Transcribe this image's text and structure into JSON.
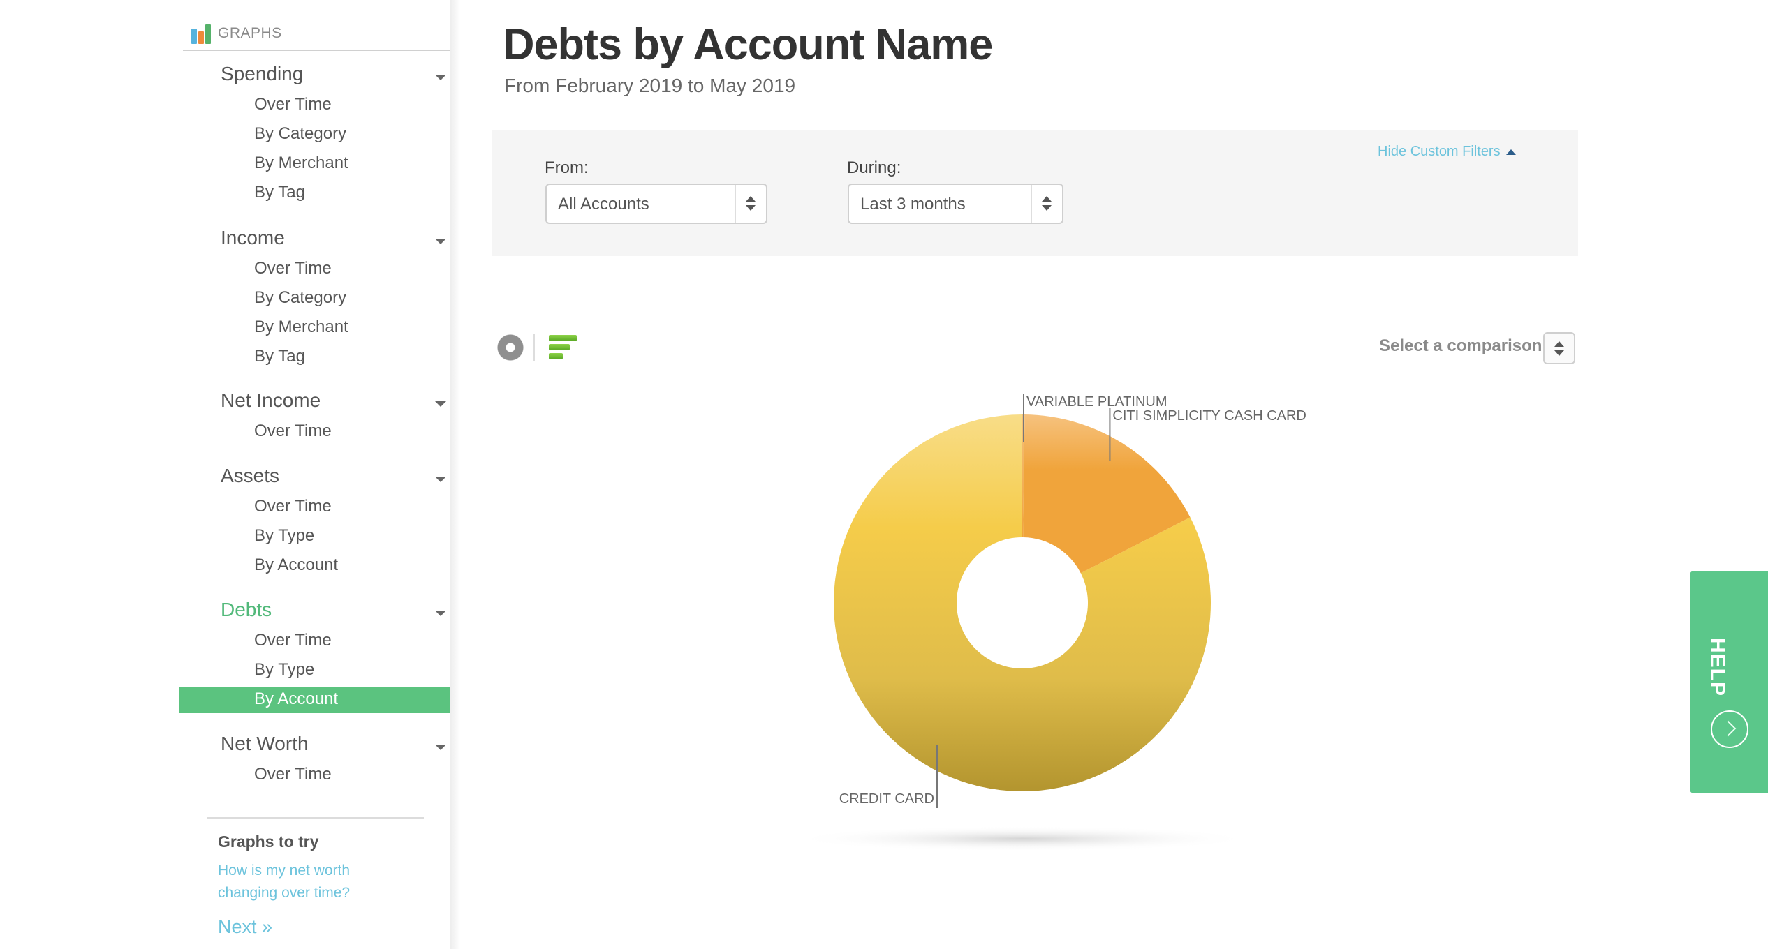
{
  "sidebar": {
    "header": {
      "label": "GRAPHS",
      "icon": "bar-chart-icon"
    },
    "sections": [
      {
        "label": "Spending",
        "items": [
          "Over Time",
          "By Category",
          "By Merchant",
          "By Tag"
        ]
      },
      {
        "label": "Income",
        "items": [
          "Over Time",
          "By Category",
          "By Merchant",
          "By Tag"
        ]
      },
      {
        "label": "Net Income",
        "items": [
          "Over Time"
        ]
      },
      {
        "label": "Assets",
        "items": [
          "Over Time",
          "By Type",
          "By Account"
        ]
      },
      {
        "label": "Debts",
        "items": [
          "Over Time",
          "By Type",
          "By Account"
        ],
        "active": true,
        "active_item": "By Account"
      },
      {
        "label": "Net Worth",
        "items": [
          "Over Time"
        ]
      }
    ],
    "graphs_to_try": {
      "title": "Graphs to try",
      "link": "How is my net worth changing over time?",
      "next": "Next »"
    }
  },
  "header": {
    "title": "Debts by Account Name",
    "subtitle": "From February 2019 to May 2019"
  },
  "filters": {
    "from_label": "From:",
    "from_value": "All Accounts",
    "during_label": "During:",
    "during_value": "Last 3 months",
    "hide_label": "Hide Custom Filters"
  },
  "chart_controls": {
    "donut_icon": "donut-chart-icon",
    "bars_icon": "bar-list-icon",
    "comparison_label": "Select a comparison"
  },
  "help": {
    "label": "HELP"
  },
  "colors": {
    "accent_green": "#5bc37f",
    "link_blue": "#6cc3dc",
    "credit_card": "#f3c94a",
    "citi": "#f0a63c",
    "variable_platinum": "#f2b86a"
  },
  "chart_data": {
    "type": "pie",
    "variant": "donut",
    "title": "Debts by Account Name",
    "subtitle": "From February 2019 to May 2019",
    "unit": "percent (estimated from slice angles)",
    "slices": [
      {
        "label": "VARIABLE PLATINUM",
        "value": 0.2
      },
      {
        "label": "CITI SIMPLICITY CASH CARD",
        "value": 17.3
      },
      {
        "label": "CREDIT CARD",
        "value": 82.5
      }
    ],
    "start_angle": "12 o'clock",
    "direction": "clockwise",
    "legend": "none (leader-line labels)"
  }
}
